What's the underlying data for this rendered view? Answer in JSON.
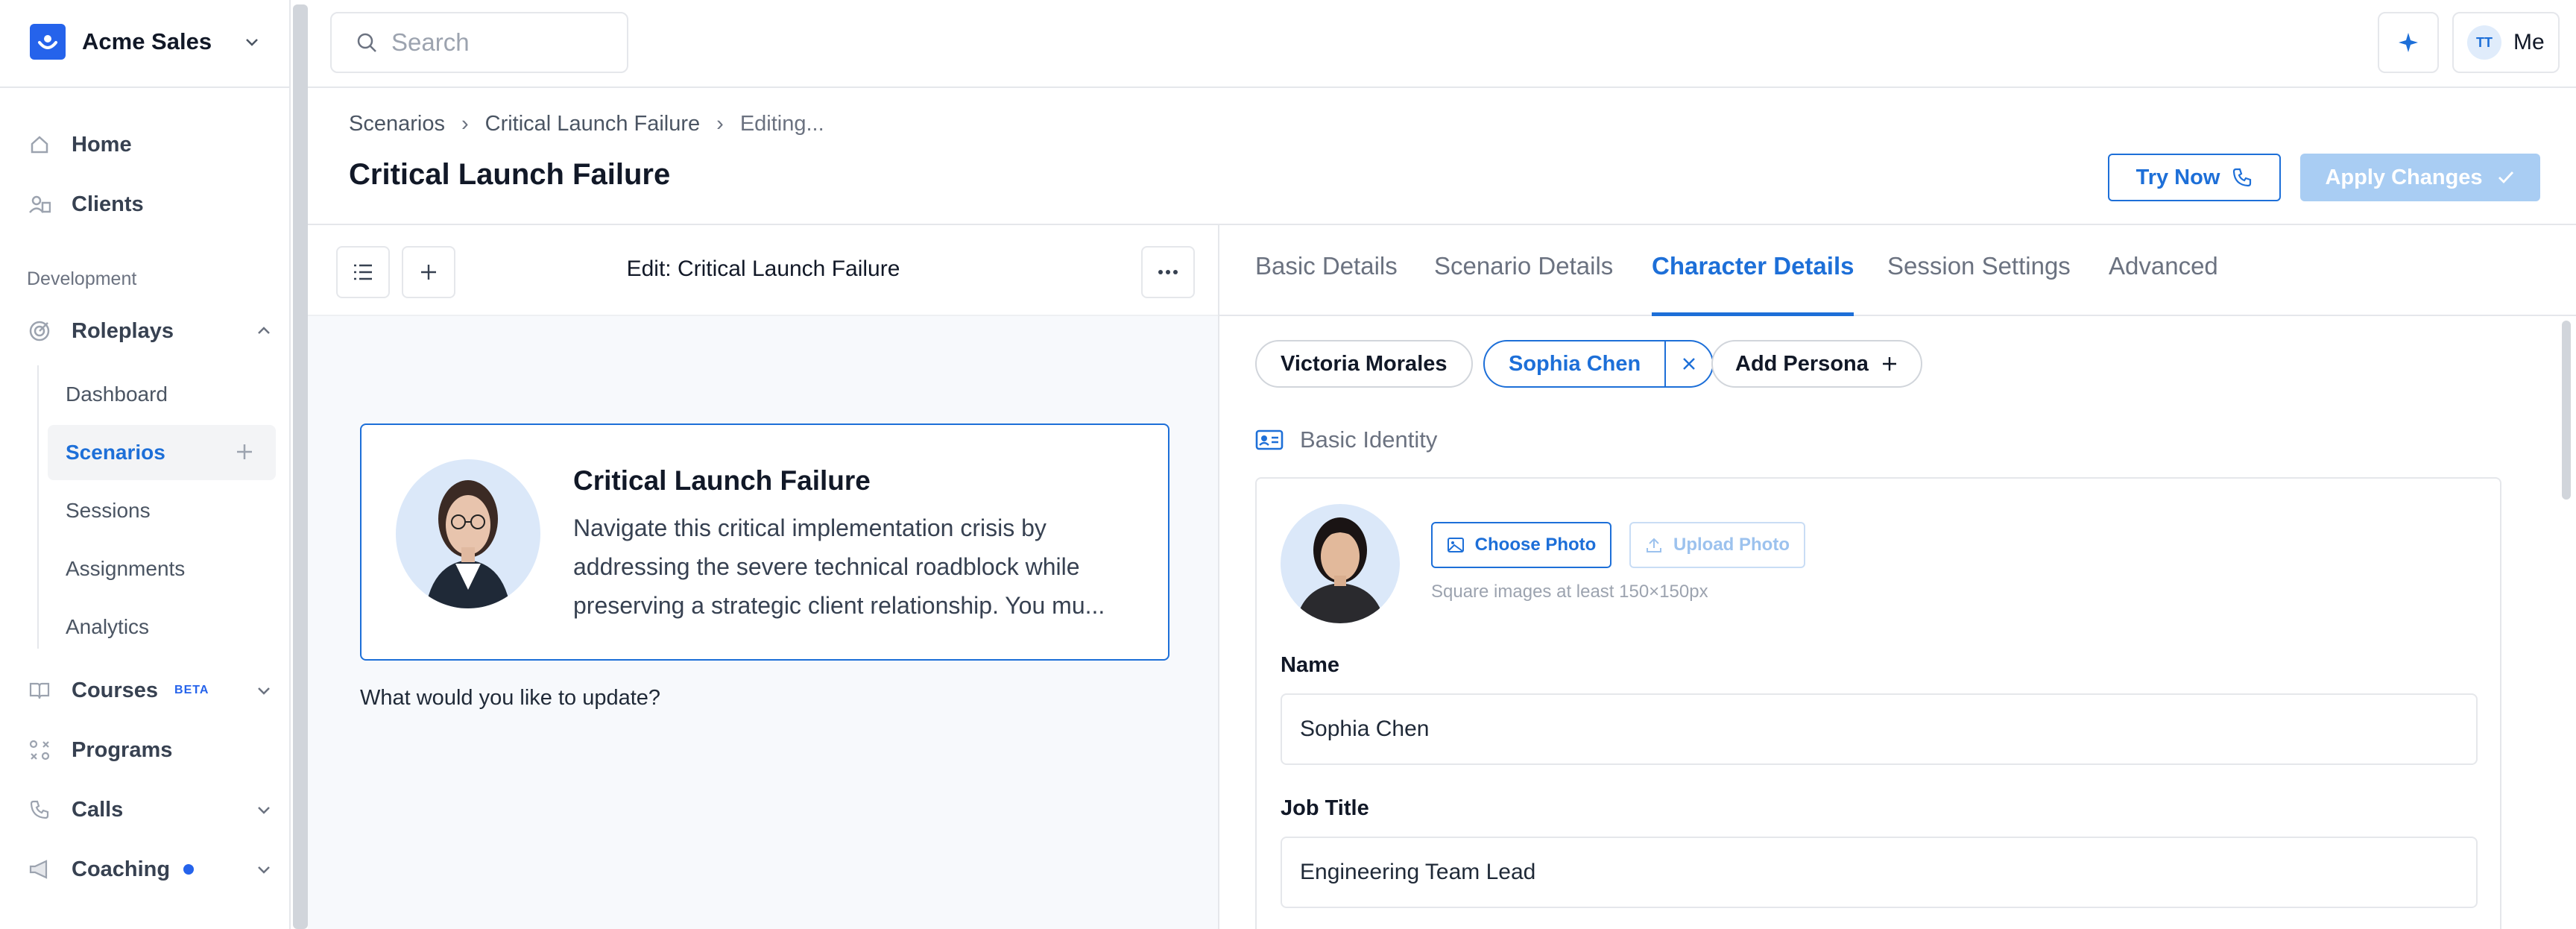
{
  "org": {
    "name": "Acme Sales"
  },
  "sidebar": {
    "items_top": [
      {
        "label": "Home",
        "icon": "home-icon"
      },
      {
        "label": "Clients",
        "icon": "clients-icon"
      }
    ],
    "section_label": "Development",
    "roleplays": {
      "label": "Roleplays",
      "icon": "target-icon"
    },
    "sub_items": [
      {
        "label": "Dashboard"
      },
      {
        "label": "Scenarios"
      },
      {
        "label": "Sessions"
      },
      {
        "label": "Assignments"
      },
      {
        "label": "Analytics"
      }
    ],
    "courses": {
      "label": "Courses",
      "badge": "BETA"
    },
    "programs": {
      "label": "Programs"
    },
    "calls": {
      "label": "Calls"
    },
    "coaching": {
      "label": "Coaching"
    }
  },
  "topbar": {
    "search_placeholder": "Search",
    "user_initials": "TT",
    "user_label": "Me"
  },
  "breadcrumb": [
    "Scenarios",
    "Critical Launch Failure",
    "Editing..."
  ],
  "page": {
    "title": "Critical Launch Failure",
    "try_now": "Try Now",
    "apply_changes": "Apply Changes"
  },
  "editor": {
    "title": "Edit: Critical Launch Failure",
    "card_title": "Critical Launch Failure",
    "card_description": "Navigate this critical implementation crisis by addressing the severe technical roadblock while preserving a strategic client relationship. You mu...",
    "prompt": "What would you like to update?"
  },
  "tabs": [
    "Basic Details",
    "Scenario Details",
    "Character Details",
    "Session Settings",
    "Advanced"
  ],
  "active_tab": "Character Details",
  "personas": {
    "items": [
      "Victoria Morales",
      "Sophia Chen"
    ],
    "selected": "Sophia Chen",
    "add_label": "Add Persona"
  },
  "identity": {
    "section_title": "Basic Identity",
    "choose_photo": "Choose Photo",
    "upload_photo": "Upload Photo",
    "hint": "Square images at least 150×150px",
    "name_label": "Name",
    "name_value": "Sophia Chen",
    "job_label": "Job Title",
    "job_value": "Engineering Team Lead"
  },
  "colors": {
    "accent": "#1d6fd8",
    "accent_disabled": "#a9cdf3",
    "border": "#e5e7eb",
    "text": "#111827"
  }
}
